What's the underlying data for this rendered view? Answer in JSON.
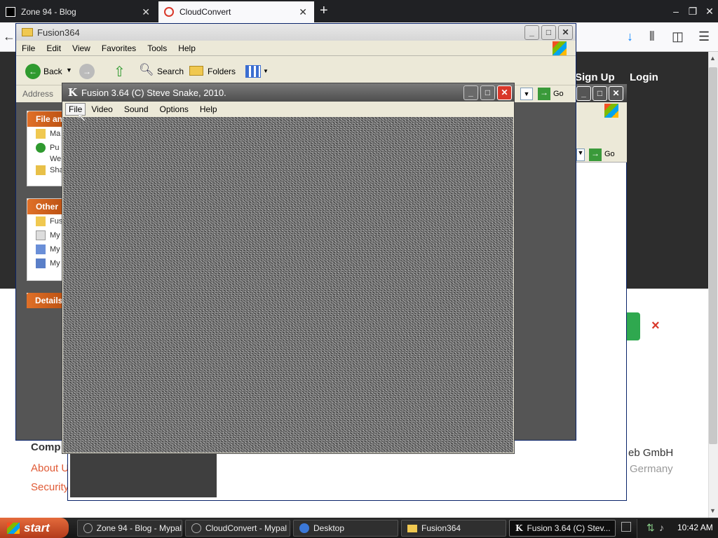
{
  "browser": {
    "tabs": [
      {
        "title": "Zone 94 - Blog"
      },
      {
        "title": "CloudConvert"
      }
    ],
    "new_tab": "+",
    "window_controls": {
      "minimize": "–",
      "restore": "❐",
      "close": "✕"
    },
    "toolbar": {
      "back": "←",
      "downloads": "↓",
      "library": "⫴",
      "sidebar": "◫",
      "menu": "☰"
    }
  },
  "webpage": {
    "signup": "Sign Up",
    "login": "Login",
    "footer_heading": "Comp",
    "links": [
      "About U",
      "Security"
    ],
    "company_right": "eb GmbH",
    "country": "Germany",
    "dismiss": "×",
    "go_label": "Go"
  },
  "explorer": {
    "title": "Fusion364",
    "menu": [
      "File",
      "Edit",
      "View",
      "Favorites",
      "Tools",
      "Help"
    ],
    "toolbar": {
      "back": "Back",
      "search": "Search",
      "folders": "Folders"
    },
    "address_label": "Address",
    "go_label": "Go",
    "panels": [
      {
        "title": "File an",
        "items": [
          "Ma",
          "Pu",
          "We",
          "Sha"
        ]
      },
      {
        "title": "Other",
        "items": [
          "Fus",
          "My",
          "My",
          "My"
        ]
      },
      {
        "title": "Details",
        "items": []
      }
    ]
  },
  "fusion": {
    "title": "Fusion 3.64 (C) Steve Snake, 2010.",
    "menu": [
      "File",
      "Video",
      "Sound",
      "Options",
      "Help"
    ]
  },
  "taskbar": {
    "start": "start",
    "items": [
      {
        "label": "Zone 94 - Blog - Mypal"
      },
      {
        "label": "CloudConvert - Mypal"
      },
      {
        "label": "Desktop"
      },
      {
        "label": "Fusion364"
      },
      {
        "label": "Fusion 3.64 (C) Stev..."
      }
    ],
    "clock": "10:42 AM"
  },
  "colors": {
    "xp_title": "#0a246a",
    "accent_orange": "#e07028",
    "hero_dark": "#2d2d2d",
    "green_button": "#2fa84f",
    "close_red": "#d9382a"
  }
}
